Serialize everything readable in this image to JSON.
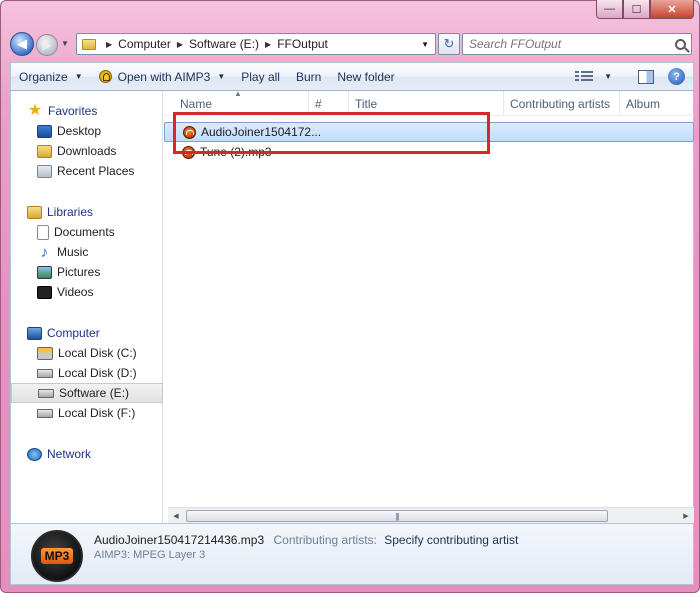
{
  "window": {
    "caption_buttons": {
      "minimize": "—",
      "maximize": "☐",
      "close": "✕"
    }
  },
  "address": {
    "breadcrumbs": [
      "Computer",
      "Software (E:)",
      "FFOutput"
    ],
    "search_placeholder": "Search FFOutput"
  },
  "toolbar": {
    "organize": "Organize",
    "open_with": "Open with AIMP3",
    "play_all": "Play all",
    "burn": "Burn",
    "new_folder": "New folder"
  },
  "nav": {
    "favorites": {
      "label": "Favorites",
      "items": [
        "Desktop",
        "Downloads",
        "Recent Places"
      ]
    },
    "libraries": {
      "label": "Libraries",
      "items": [
        "Documents",
        "Music",
        "Pictures",
        "Videos"
      ]
    },
    "computer": {
      "label": "Computer",
      "items": [
        "Local Disk (C:)",
        "Local Disk (D:)",
        "Software (E:)",
        "Local Disk (F:)"
      ],
      "selected": "Software (E:)"
    },
    "network": {
      "label": "Network"
    }
  },
  "columns": [
    "Name",
    "#",
    "Title",
    "Contributing artists",
    "Album"
  ],
  "files": [
    {
      "name": "AudioJoiner1504172...",
      "selected": true
    },
    {
      "name": "Tune (2).mp3",
      "selected": false
    }
  ],
  "details": {
    "icon_text": "MP3",
    "file_name": "AudioJoiner150417214436.mp3",
    "artists_label": "Contributing artists:",
    "artists_value": "Specify contributing artist",
    "type": "AIMP3: MPEG Layer 3"
  }
}
